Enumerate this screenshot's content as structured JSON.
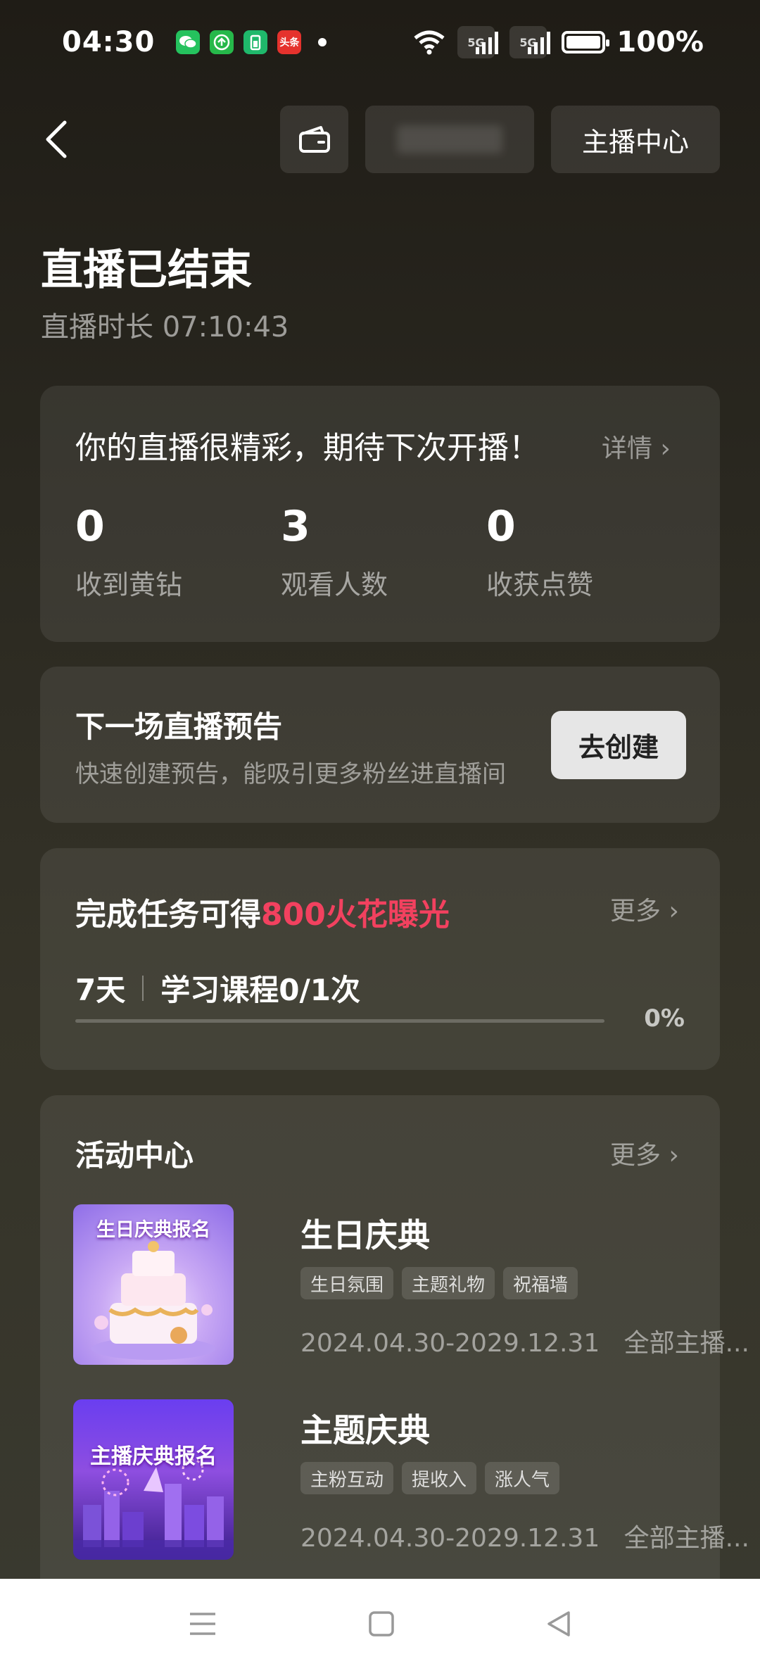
{
  "status_bar": {
    "time": "04:30",
    "battery": "100%",
    "notif_badge": "头条",
    "net1": "5G",
    "net2": "5G"
  },
  "header": {
    "anchor_center": "主播中心"
  },
  "page": {
    "title": "直播已结束",
    "duration": "直播时长 07:10:43"
  },
  "summary": {
    "headline": "你的直播很精彩，期待下次开播！",
    "detail": "详情",
    "stats": [
      {
        "value": "0",
        "label": "收到黄钻"
      },
      {
        "value": "3",
        "label": "观看人数"
      },
      {
        "value": "0",
        "label": "收获点赞"
      }
    ]
  },
  "next_live": {
    "title": "下一场直播预告",
    "subtitle": "快速创建预告，能吸引更多粉丝进直播间",
    "button": "去创建"
  },
  "task": {
    "title_prefix": "完成任务可得",
    "title_highlight": "800火花曝光",
    "more": "更多",
    "days": "7天",
    "course": "学习课程0/1次",
    "percent": "0%",
    "progress": 0
  },
  "activities": {
    "title": "活动中心",
    "more": "更多",
    "items": [
      {
        "thumb_caption": "生日庆典报名",
        "title": "生日庆典",
        "tags": [
          "生日氛围",
          "主题礼物",
          "祝福墙"
        ],
        "period": "2024.04.30-2029.12.31",
        "scope": "全部主播..."
      },
      {
        "thumb_caption": "主播庆典报名",
        "title": "主题庆典",
        "tags": [
          "主粉互动",
          "提收入",
          "涨人气"
        ],
        "period": "2024.04.30-2029.12.31",
        "scope": "全部主播..."
      }
    ]
  },
  "colors": {
    "accent": "#f2415f"
  }
}
